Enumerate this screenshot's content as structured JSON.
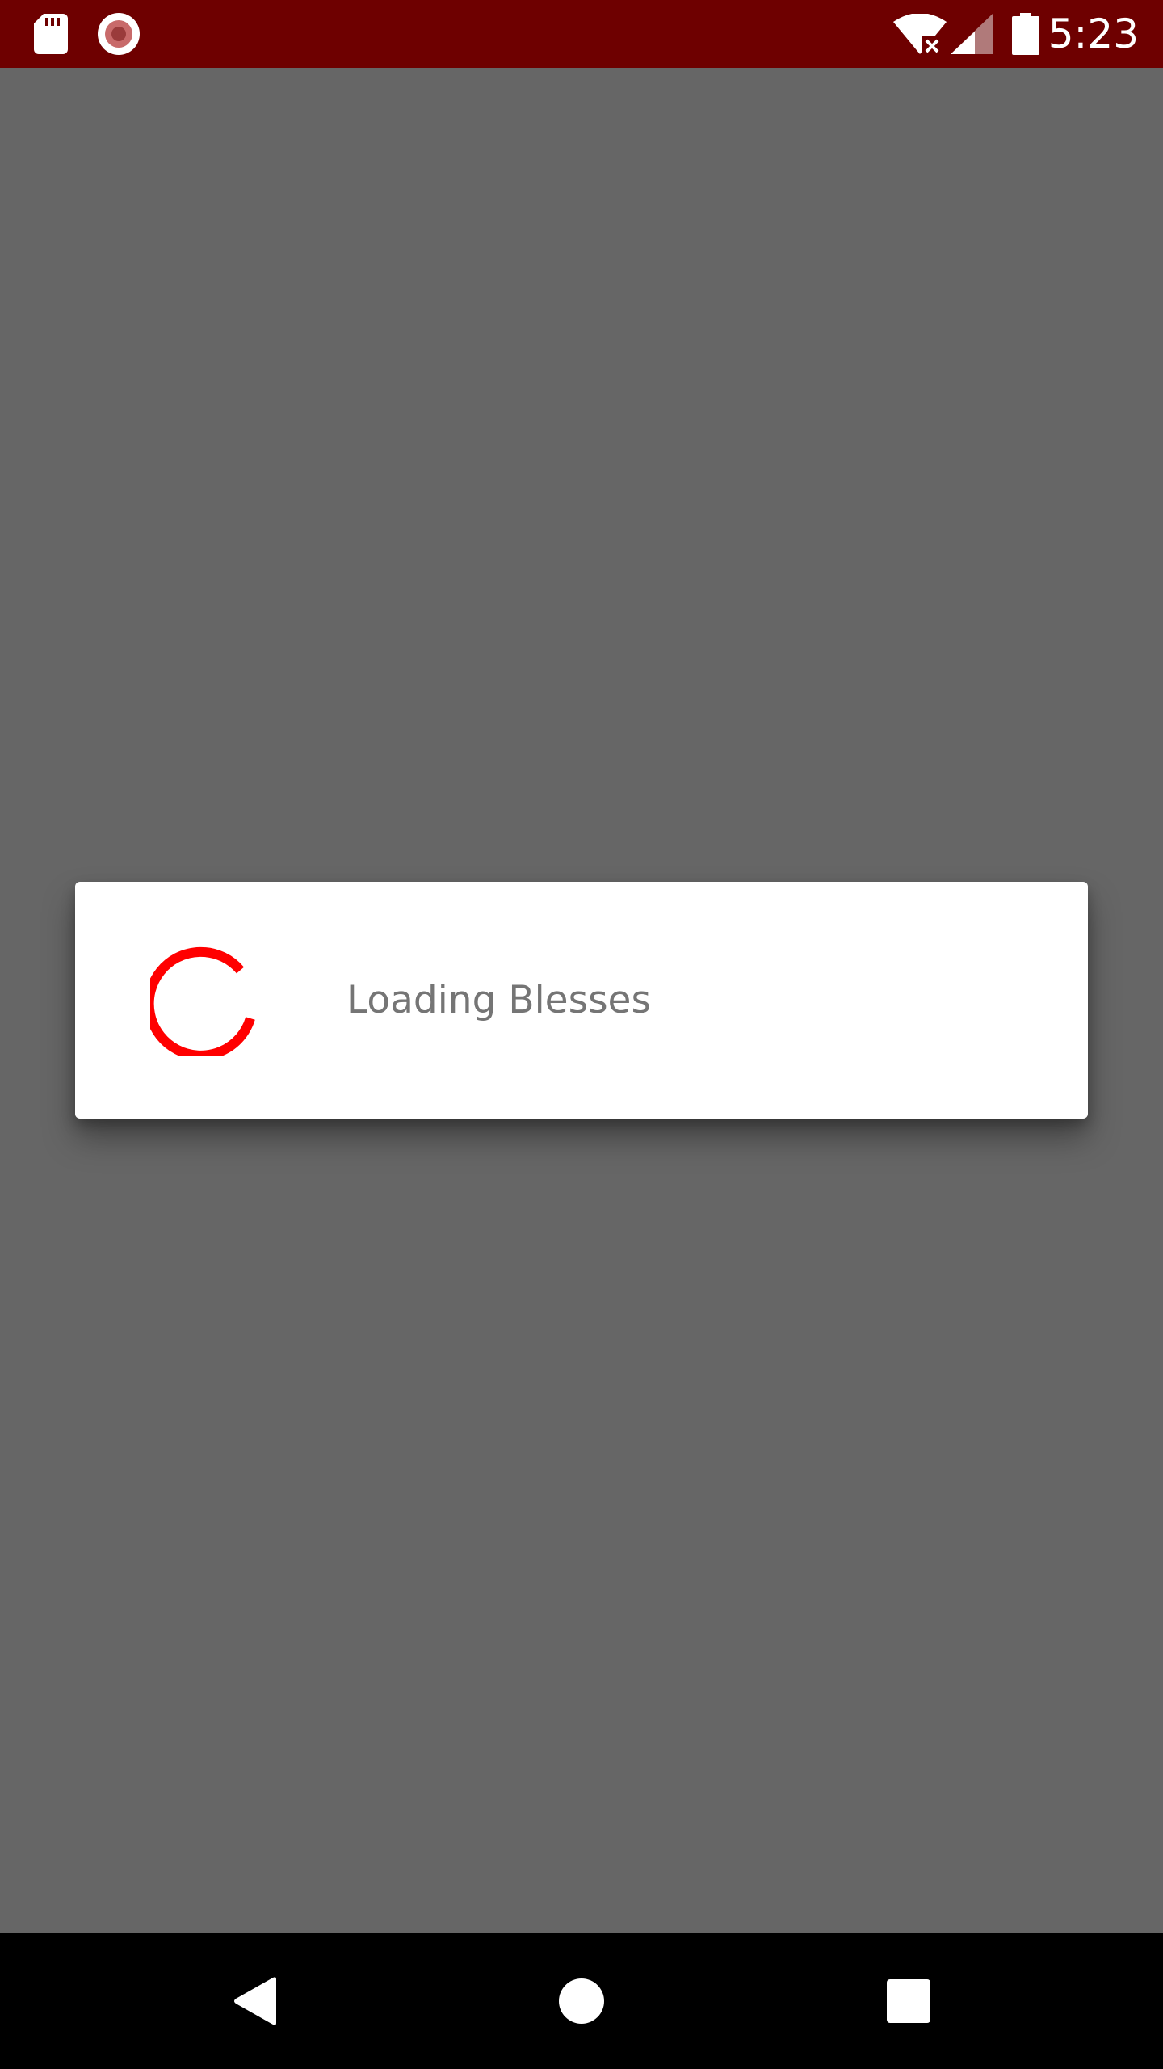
{
  "status_bar": {
    "time": "5:23",
    "icons": [
      "sd-card-icon",
      "record-icon",
      "wifi-off-icon",
      "cell-signal-icon",
      "battery-icon"
    ],
    "background": "#6e0000"
  },
  "dialog": {
    "message": "Loading Blesses",
    "spinner_color": "#ff0000"
  },
  "nav_bar": {
    "buttons": [
      "back-icon",
      "home-icon",
      "recents-icon"
    ]
  },
  "colors": {
    "scrim": "#666666",
    "status_bar": "#6e0000",
    "accent": "#ff0000"
  }
}
